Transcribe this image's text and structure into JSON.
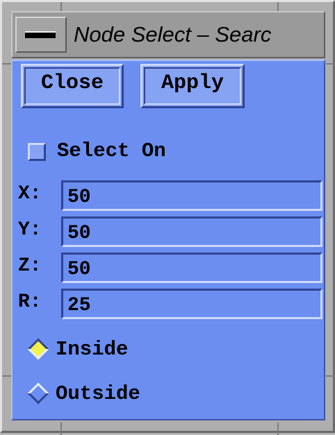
{
  "window": {
    "title": "Node Select – Searc",
    "menu_icon": "window-menu-icon"
  },
  "buttons": {
    "close_label": "Close",
    "apply_label": "Apply"
  },
  "select_on": {
    "label": "Select On",
    "checked": false
  },
  "fields": [
    {
      "label": "X:",
      "value": "50"
    },
    {
      "label": "Y:",
      "value": "50"
    },
    {
      "label": "Z:",
      "value": "50"
    },
    {
      "label": "R:",
      "value": "25"
    }
  ],
  "region": {
    "options": [
      {
        "label": "Inside",
        "selected": true
      },
      {
        "label": "Outside",
        "selected": false
      }
    ]
  },
  "colors": {
    "client_bg": "#6b8ef0",
    "frame": "#aeaeae",
    "radio_selected": "#f3f24a"
  }
}
